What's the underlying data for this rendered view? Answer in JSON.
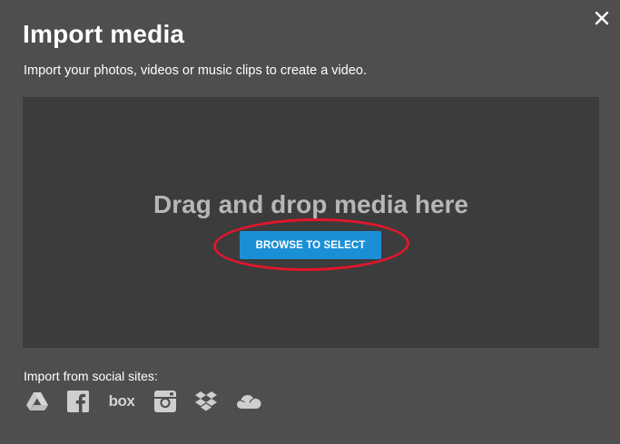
{
  "dialog": {
    "title": "Import media",
    "subtitle": "Import your photos, videos or music clips to create a video.",
    "close_icon": "close-icon"
  },
  "dropzone": {
    "text": "Drag and drop media here",
    "browse_label": "BROWSE TO SELECT",
    "button_color": "#1b8fd6",
    "highlight_color": "#e2162b"
  },
  "social": {
    "label": "Import from social sites:",
    "icons": [
      "google-drive-icon",
      "facebook-icon",
      "box-icon",
      "instagram-icon",
      "dropbox-icon",
      "onedrive-icon"
    ],
    "box_text": "box"
  }
}
